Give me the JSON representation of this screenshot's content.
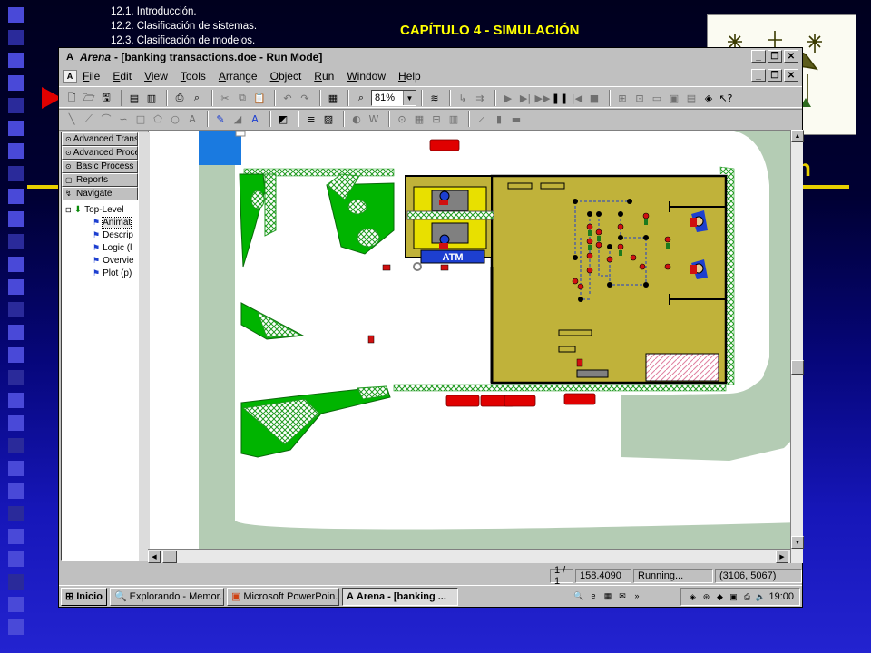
{
  "slide": {
    "topics": [
      "12.1. Introducción.",
      "12.2. Clasificación de sistemas.",
      "12.3. Clasificación de modelos."
    ],
    "chapter_title": "CAPÍTULO 4 - SIMULACIÓN",
    "gold_letter": "n",
    "colors": {
      "background": "#00003a",
      "title": "#ffff00",
      "accent_square": "#4949d8",
      "gold_line": "#e8d000",
      "red_triangle": "#e00000"
    }
  },
  "window": {
    "app_name": "Arena",
    "document_title": "- [banking transactions.doe - Run Mode]",
    "buttons": {
      "minimize": "_",
      "restore": "❐",
      "close": "✕"
    },
    "inner_buttons": {
      "minimize": "_",
      "restore": "❐",
      "close": "✕"
    }
  },
  "menu": {
    "items": [
      "File",
      "Edit",
      "View",
      "Tools",
      "Arrange",
      "Object",
      "Run",
      "Window",
      "Help"
    ]
  },
  "toolbar": {
    "zoom_value": "81%"
  },
  "project_bar": {
    "panels": [
      "Advanced Transfer",
      "Advanced Process",
      "Basic Process",
      "Reports",
      "Navigate"
    ],
    "tree_root": "Top-Level",
    "tree_items": [
      "Animat",
      "Descrip",
      "Logic (l",
      "Overvie",
      "Plot (p)"
    ]
  },
  "canvas": {
    "atm_label": "ATM",
    "colors": {
      "floor": "#c0b23a",
      "grass": "#00b400",
      "road": "#b4ccb4",
      "parking": "#ffffff",
      "car": "#e00000"
    }
  },
  "status": {
    "page": "1 / 1",
    "sim_time": "158.4090",
    "state": "Running...",
    "coords": "(3106, 5067)"
  },
  "taskbar": {
    "start_label": "Inicio",
    "tasks": [
      "Explorando - Memor...",
      "Microsoft PowerPoin...",
      "Arena - [banking ..."
    ],
    "clock": "19:00"
  }
}
